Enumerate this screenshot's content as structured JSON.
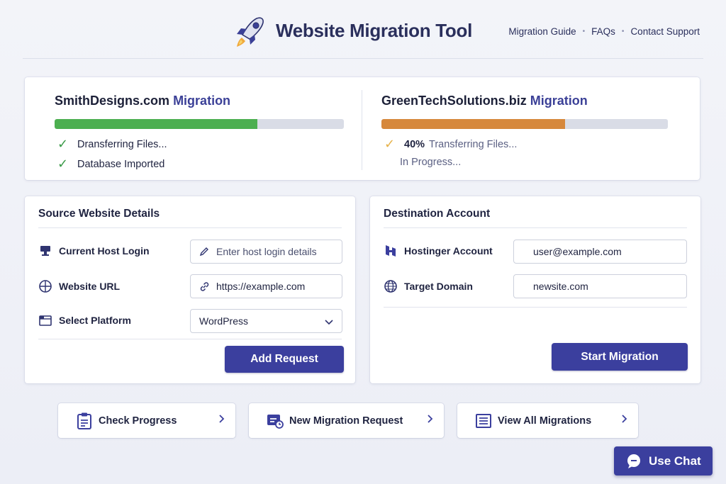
{
  "header": {
    "title": "Website Migration Tool",
    "nav": [
      "Migration Guide",
      "FAQs",
      "Contact Support"
    ],
    "logo_icon": "rocket-icon"
  },
  "migrations": [
    {
      "name": "SmithDesigns.com",
      "suffix": "Migration",
      "progress": 0.7,
      "bar_color": "#4caf50",
      "status_lines": [
        {
          "icon": "checkmark-icon",
          "icon_color": "#3a9a48",
          "text": "Dransferring Files..."
        },
        {
          "icon": "checkmark-icon",
          "icon_color": "#3a9a48",
          "text": "Database Imported"
        }
      ]
    },
    {
      "name": "GreenTechSolutions.biz",
      "suffix": "Migration",
      "progress": 0.64,
      "bar_color": "#d6883c",
      "status_lines": [
        {
          "icon": "checkmark-icon",
          "icon_color": "#e6b24a",
          "percent": "40%",
          "text": "Transferring Files..."
        },
        {
          "text": "In Progress..."
        }
      ]
    }
  ],
  "source": {
    "title": "Source Website Details",
    "fields": [
      {
        "label": "Current Host Login",
        "icon": "host-login-icon",
        "value": "",
        "placeholder": "Enter host login details",
        "input_icon": "pencil-icon"
      },
      {
        "label": "Website URL",
        "icon": "globe-icon",
        "value": "https://example.com",
        "input_icon": "link-icon"
      },
      {
        "label": "Select Platform",
        "icon": "browser-window-icon",
        "value": "WordPress"
      }
    ],
    "button": "Add Request"
  },
  "destination": {
    "title": "Destination Account",
    "fields": [
      {
        "label": "Hostinger Account",
        "icon": "hostinger-logo-icon",
        "value": "user@example.com"
      },
      {
        "label": "Target Domain",
        "icon": "globe-icon",
        "value": "newsite.com"
      }
    ],
    "button": "Start Migration"
  },
  "quick_actions": [
    {
      "label": "Check Progress",
      "icon": "clipboard-icon"
    },
    {
      "label": "New Migration Request",
      "icon": "new-request-icon"
    },
    {
      "label": "View All Migrations",
      "icon": "list-icon"
    }
  ],
  "chat": {
    "label": "Use Chat",
    "icon": "chat-bubble-icon"
  },
  "colors": {
    "accent": "#3b3f9e",
    "title": "#2a2f5c"
  }
}
